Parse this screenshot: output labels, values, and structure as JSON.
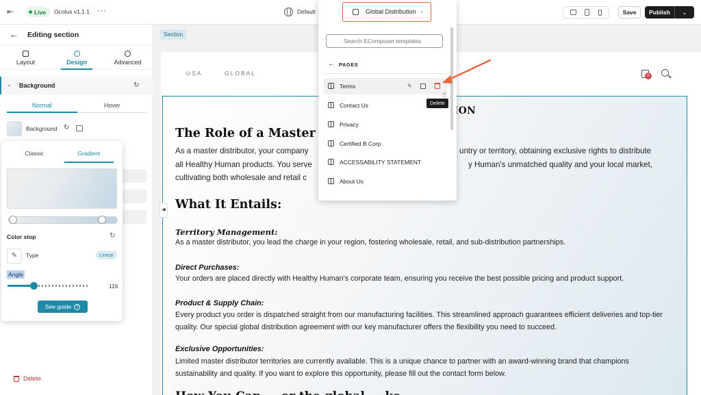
{
  "topbar": {
    "live": "Live",
    "version": "Ocolus v1.1.1",
    "more": "···",
    "language": "Default",
    "template": "Global Distribution",
    "save": "Save",
    "publish": "Publish"
  },
  "leftpanel": {
    "title": "Editing section",
    "tabs": [
      {
        "label": "Layout",
        "icon": "layout-icon"
      },
      {
        "label": "Design",
        "icon": "palette-icon"
      },
      {
        "label": "Advanced",
        "icon": "gear-icon"
      }
    ],
    "section_title": "Background",
    "states": [
      "Normal",
      "Hover"
    ],
    "background_label": "Background",
    "delete": "Delete"
  },
  "gradient": {
    "tabs": [
      "Classic",
      "Gradient"
    ],
    "color_stop": "Color stop",
    "type_label": "Type",
    "type_value": "Linear",
    "angle_label": "Angle",
    "angle_value": "116",
    "guide": "See guide",
    "angle_percent": 32
  },
  "canvas": {
    "section_tag": "Section",
    "nav": [
      "USA",
      "GLOBAL"
    ],
    "cart_count": "0",
    "section_heading": "TION",
    "role_heading": "The Role of a Master Dist",
    "intro_left": "As a master distributor, your company",
    "intro_right": "untry or territory, obtaining exclusive rights to distribute",
    "intro_l2_left": "all Healthy Human products. You serve",
    "intro_l2_right": "y Human's unmatched quality and your local market,",
    "intro_l3": "cultivating both wholesale and retail c",
    "entails": "What It Entails:",
    "blocks": [
      {
        "title": "Territory Management:",
        "text": "As a master distributor, you lead the charge in your region, fostering wholesale, retail, and sub-distribution partnerships."
      },
      {
        "title": "Direct Purchases:",
        "text": "Your orders are placed directly with Healthy Human's corporate team, ensuring you receive the best possible pricing and product support."
      },
      {
        "title": "Product & Supply Chain:",
        "text": "Every product you order is dispatched straight from our manufacturing facilities. This streamlined approach guarantees efficient deliveries and top-tier quality. Our special global distribution agreement with our key manufacturer offers the flexibility you need to succeed."
      },
      {
        "title": "Exclusive Opportunities:",
        "text": "Limited master distributor territories are currently available. This is a unique chance to partner with an award-winning brand that champions sustainability and quality. If you want to explore this opportunity, please fill out the contact form below."
      }
    ],
    "bottom_heading": "How You Can ... or the global ... ke"
  },
  "templates": {
    "search_placeholder": "Search EComposer templates",
    "group": "PAGES",
    "items": [
      "Terms",
      "Contact Us",
      "Privacy",
      "Certified B Corp",
      "ACCESSABILITY STATEMENT",
      "About Us"
    ],
    "tooltip": "Delete"
  },
  "colors": {
    "accent": "#1e8aa8",
    "highlight": "#e8643c",
    "danger": "#e0463a"
  }
}
